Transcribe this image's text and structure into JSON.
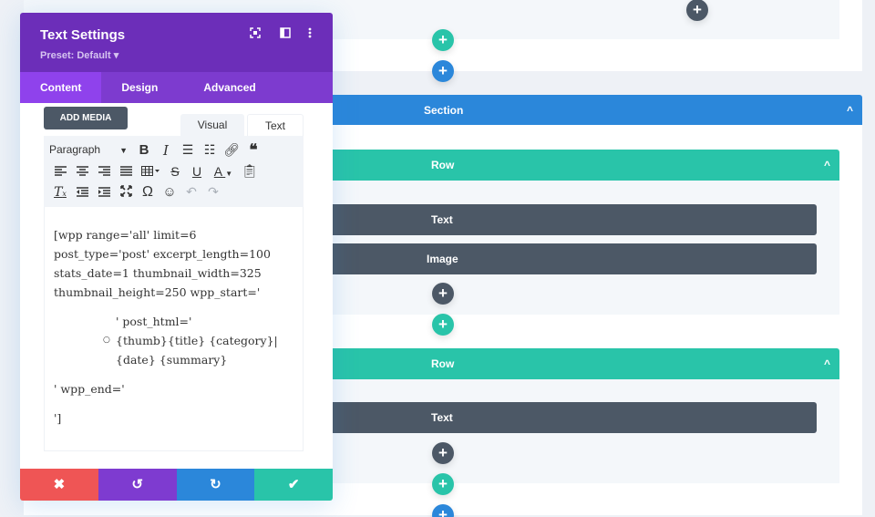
{
  "modal": {
    "title": "Text Settings",
    "preset": "Preset: Default ▾",
    "header_icons": [
      "fullscreen-icon",
      "split-view-icon",
      "more-options-icon"
    ],
    "tabs": [
      {
        "label": "Content",
        "active": true
      },
      {
        "label": "Design",
        "active": false
      },
      {
        "label": "Advanced",
        "active": false
      }
    ],
    "add_media_label": "ADD MEDIA",
    "editor_tabs": {
      "visual": "Visual",
      "text": "Text"
    },
    "toolbar": {
      "format_select": "Paragraph",
      "row1": [
        "bold",
        "italic",
        "bullet-list",
        "numbered-list",
        "link",
        "blockquote"
      ],
      "row2": [
        "align-left",
        "align-center",
        "align-right",
        "justify",
        "table",
        "strikethrough",
        "underline",
        "text-color",
        "paste-as-text"
      ],
      "row3": [
        "clear-formatting",
        "outdent",
        "indent",
        "fullscreen",
        "special-character",
        "emoji",
        "undo",
        "redo"
      ]
    },
    "content": {
      "line1": "[wpp range='all' limit=6 post_type='post' excerpt_length=100 stats_date=1 thumbnail_width=325 thumbnail_height=250 wpp_start='",
      "line2": "' post_html='",
      "list_item": "{thumb}{title} {category}|{date} {summary}",
      "line3": "' wpp_end='",
      "line4": "']"
    },
    "footer": {
      "cancel": "✖",
      "undo": "↺",
      "redo": "↻",
      "save": "✔"
    }
  },
  "builder": {
    "section_label": "Section",
    "rows": [
      {
        "label": "Row",
        "modules": [
          "Text",
          "Image"
        ]
      },
      {
        "label": "Row",
        "modules": [
          "Text"
        ]
      }
    ],
    "plus": "+",
    "chevron": "^"
  },
  "colors": {
    "purple": "#6c2eb9",
    "blue": "#2b87da",
    "green": "#29c4a9",
    "dark": "#4c5866",
    "red": "#ef5555"
  }
}
